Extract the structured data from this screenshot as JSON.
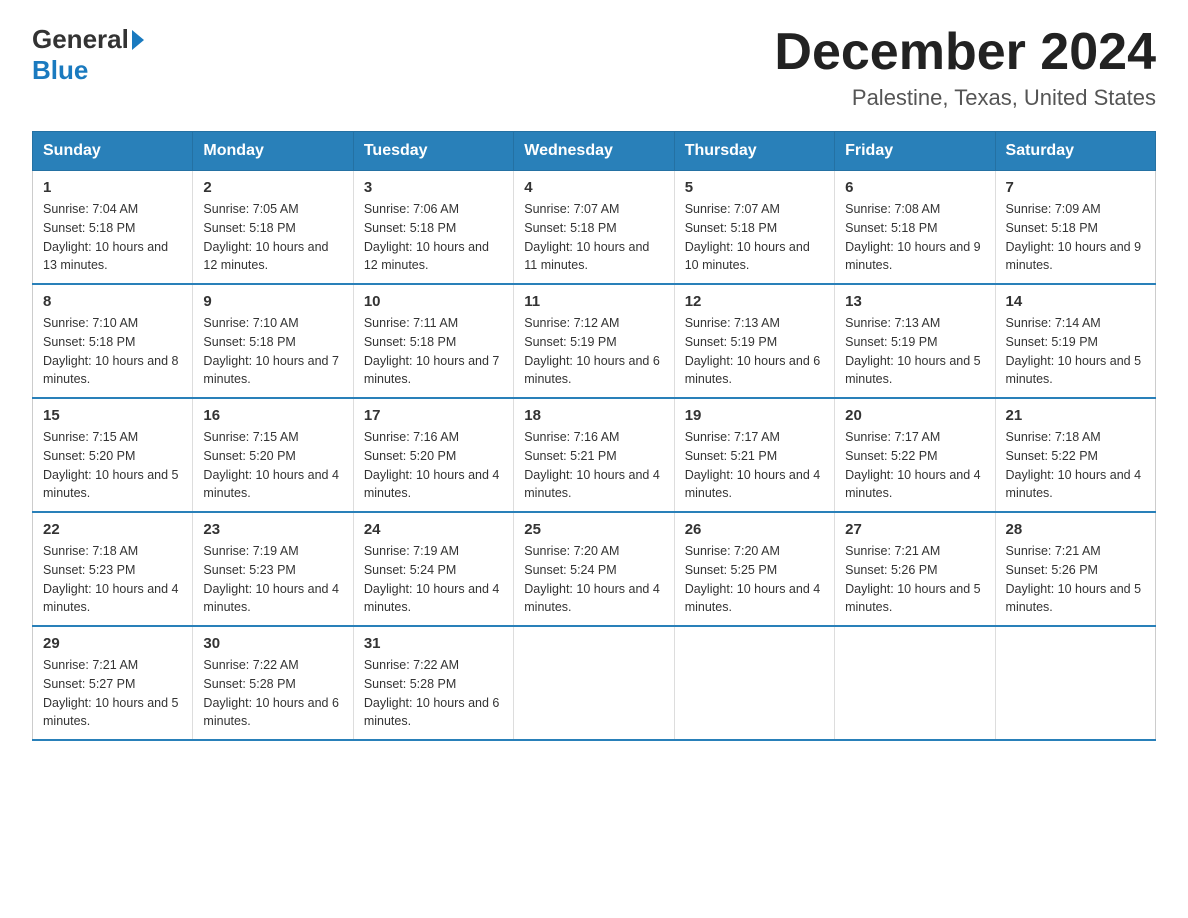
{
  "header": {
    "logo_general": "General",
    "logo_blue": "Blue",
    "month_title": "December 2024",
    "location": "Palestine, Texas, United States"
  },
  "days_of_week": [
    "Sunday",
    "Monday",
    "Tuesday",
    "Wednesday",
    "Thursday",
    "Friday",
    "Saturday"
  ],
  "weeks": [
    [
      {
        "day": "1",
        "sunrise": "7:04 AM",
        "sunset": "5:18 PM",
        "daylight": "10 hours and 13 minutes."
      },
      {
        "day": "2",
        "sunrise": "7:05 AM",
        "sunset": "5:18 PM",
        "daylight": "10 hours and 12 minutes."
      },
      {
        "day": "3",
        "sunrise": "7:06 AM",
        "sunset": "5:18 PM",
        "daylight": "10 hours and 12 minutes."
      },
      {
        "day": "4",
        "sunrise": "7:07 AM",
        "sunset": "5:18 PM",
        "daylight": "10 hours and 11 minutes."
      },
      {
        "day": "5",
        "sunrise": "7:07 AM",
        "sunset": "5:18 PM",
        "daylight": "10 hours and 10 minutes."
      },
      {
        "day": "6",
        "sunrise": "7:08 AM",
        "sunset": "5:18 PM",
        "daylight": "10 hours and 9 minutes."
      },
      {
        "day": "7",
        "sunrise": "7:09 AM",
        "sunset": "5:18 PM",
        "daylight": "10 hours and 9 minutes."
      }
    ],
    [
      {
        "day": "8",
        "sunrise": "7:10 AM",
        "sunset": "5:18 PM",
        "daylight": "10 hours and 8 minutes."
      },
      {
        "day": "9",
        "sunrise": "7:10 AM",
        "sunset": "5:18 PM",
        "daylight": "10 hours and 7 minutes."
      },
      {
        "day": "10",
        "sunrise": "7:11 AM",
        "sunset": "5:18 PM",
        "daylight": "10 hours and 7 minutes."
      },
      {
        "day": "11",
        "sunrise": "7:12 AM",
        "sunset": "5:19 PM",
        "daylight": "10 hours and 6 minutes."
      },
      {
        "day": "12",
        "sunrise": "7:13 AM",
        "sunset": "5:19 PM",
        "daylight": "10 hours and 6 minutes."
      },
      {
        "day": "13",
        "sunrise": "7:13 AM",
        "sunset": "5:19 PM",
        "daylight": "10 hours and 5 minutes."
      },
      {
        "day": "14",
        "sunrise": "7:14 AM",
        "sunset": "5:19 PM",
        "daylight": "10 hours and 5 minutes."
      }
    ],
    [
      {
        "day": "15",
        "sunrise": "7:15 AM",
        "sunset": "5:20 PM",
        "daylight": "10 hours and 5 minutes."
      },
      {
        "day": "16",
        "sunrise": "7:15 AM",
        "sunset": "5:20 PM",
        "daylight": "10 hours and 4 minutes."
      },
      {
        "day": "17",
        "sunrise": "7:16 AM",
        "sunset": "5:20 PM",
        "daylight": "10 hours and 4 minutes."
      },
      {
        "day": "18",
        "sunrise": "7:16 AM",
        "sunset": "5:21 PM",
        "daylight": "10 hours and 4 minutes."
      },
      {
        "day": "19",
        "sunrise": "7:17 AM",
        "sunset": "5:21 PM",
        "daylight": "10 hours and 4 minutes."
      },
      {
        "day": "20",
        "sunrise": "7:17 AM",
        "sunset": "5:22 PM",
        "daylight": "10 hours and 4 minutes."
      },
      {
        "day": "21",
        "sunrise": "7:18 AM",
        "sunset": "5:22 PM",
        "daylight": "10 hours and 4 minutes."
      }
    ],
    [
      {
        "day": "22",
        "sunrise": "7:18 AM",
        "sunset": "5:23 PM",
        "daylight": "10 hours and 4 minutes."
      },
      {
        "day": "23",
        "sunrise": "7:19 AM",
        "sunset": "5:23 PM",
        "daylight": "10 hours and 4 minutes."
      },
      {
        "day": "24",
        "sunrise": "7:19 AM",
        "sunset": "5:24 PM",
        "daylight": "10 hours and 4 minutes."
      },
      {
        "day": "25",
        "sunrise": "7:20 AM",
        "sunset": "5:24 PM",
        "daylight": "10 hours and 4 minutes."
      },
      {
        "day": "26",
        "sunrise": "7:20 AM",
        "sunset": "5:25 PM",
        "daylight": "10 hours and 4 minutes."
      },
      {
        "day": "27",
        "sunrise": "7:21 AM",
        "sunset": "5:26 PM",
        "daylight": "10 hours and 5 minutes."
      },
      {
        "day": "28",
        "sunrise": "7:21 AM",
        "sunset": "5:26 PM",
        "daylight": "10 hours and 5 minutes."
      }
    ],
    [
      {
        "day": "29",
        "sunrise": "7:21 AM",
        "sunset": "5:27 PM",
        "daylight": "10 hours and 5 minutes."
      },
      {
        "day": "30",
        "sunrise": "7:22 AM",
        "sunset": "5:28 PM",
        "daylight": "10 hours and 6 minutes."
      },
      {
        "day": "31",
        "sunrise": "7:22 AM",
        "sunset": "5:28 PM",
        "daylight": "10 hours and 6 minutes."
      },
      null,
      null,
      null,
      null
    ]
  ]
}
